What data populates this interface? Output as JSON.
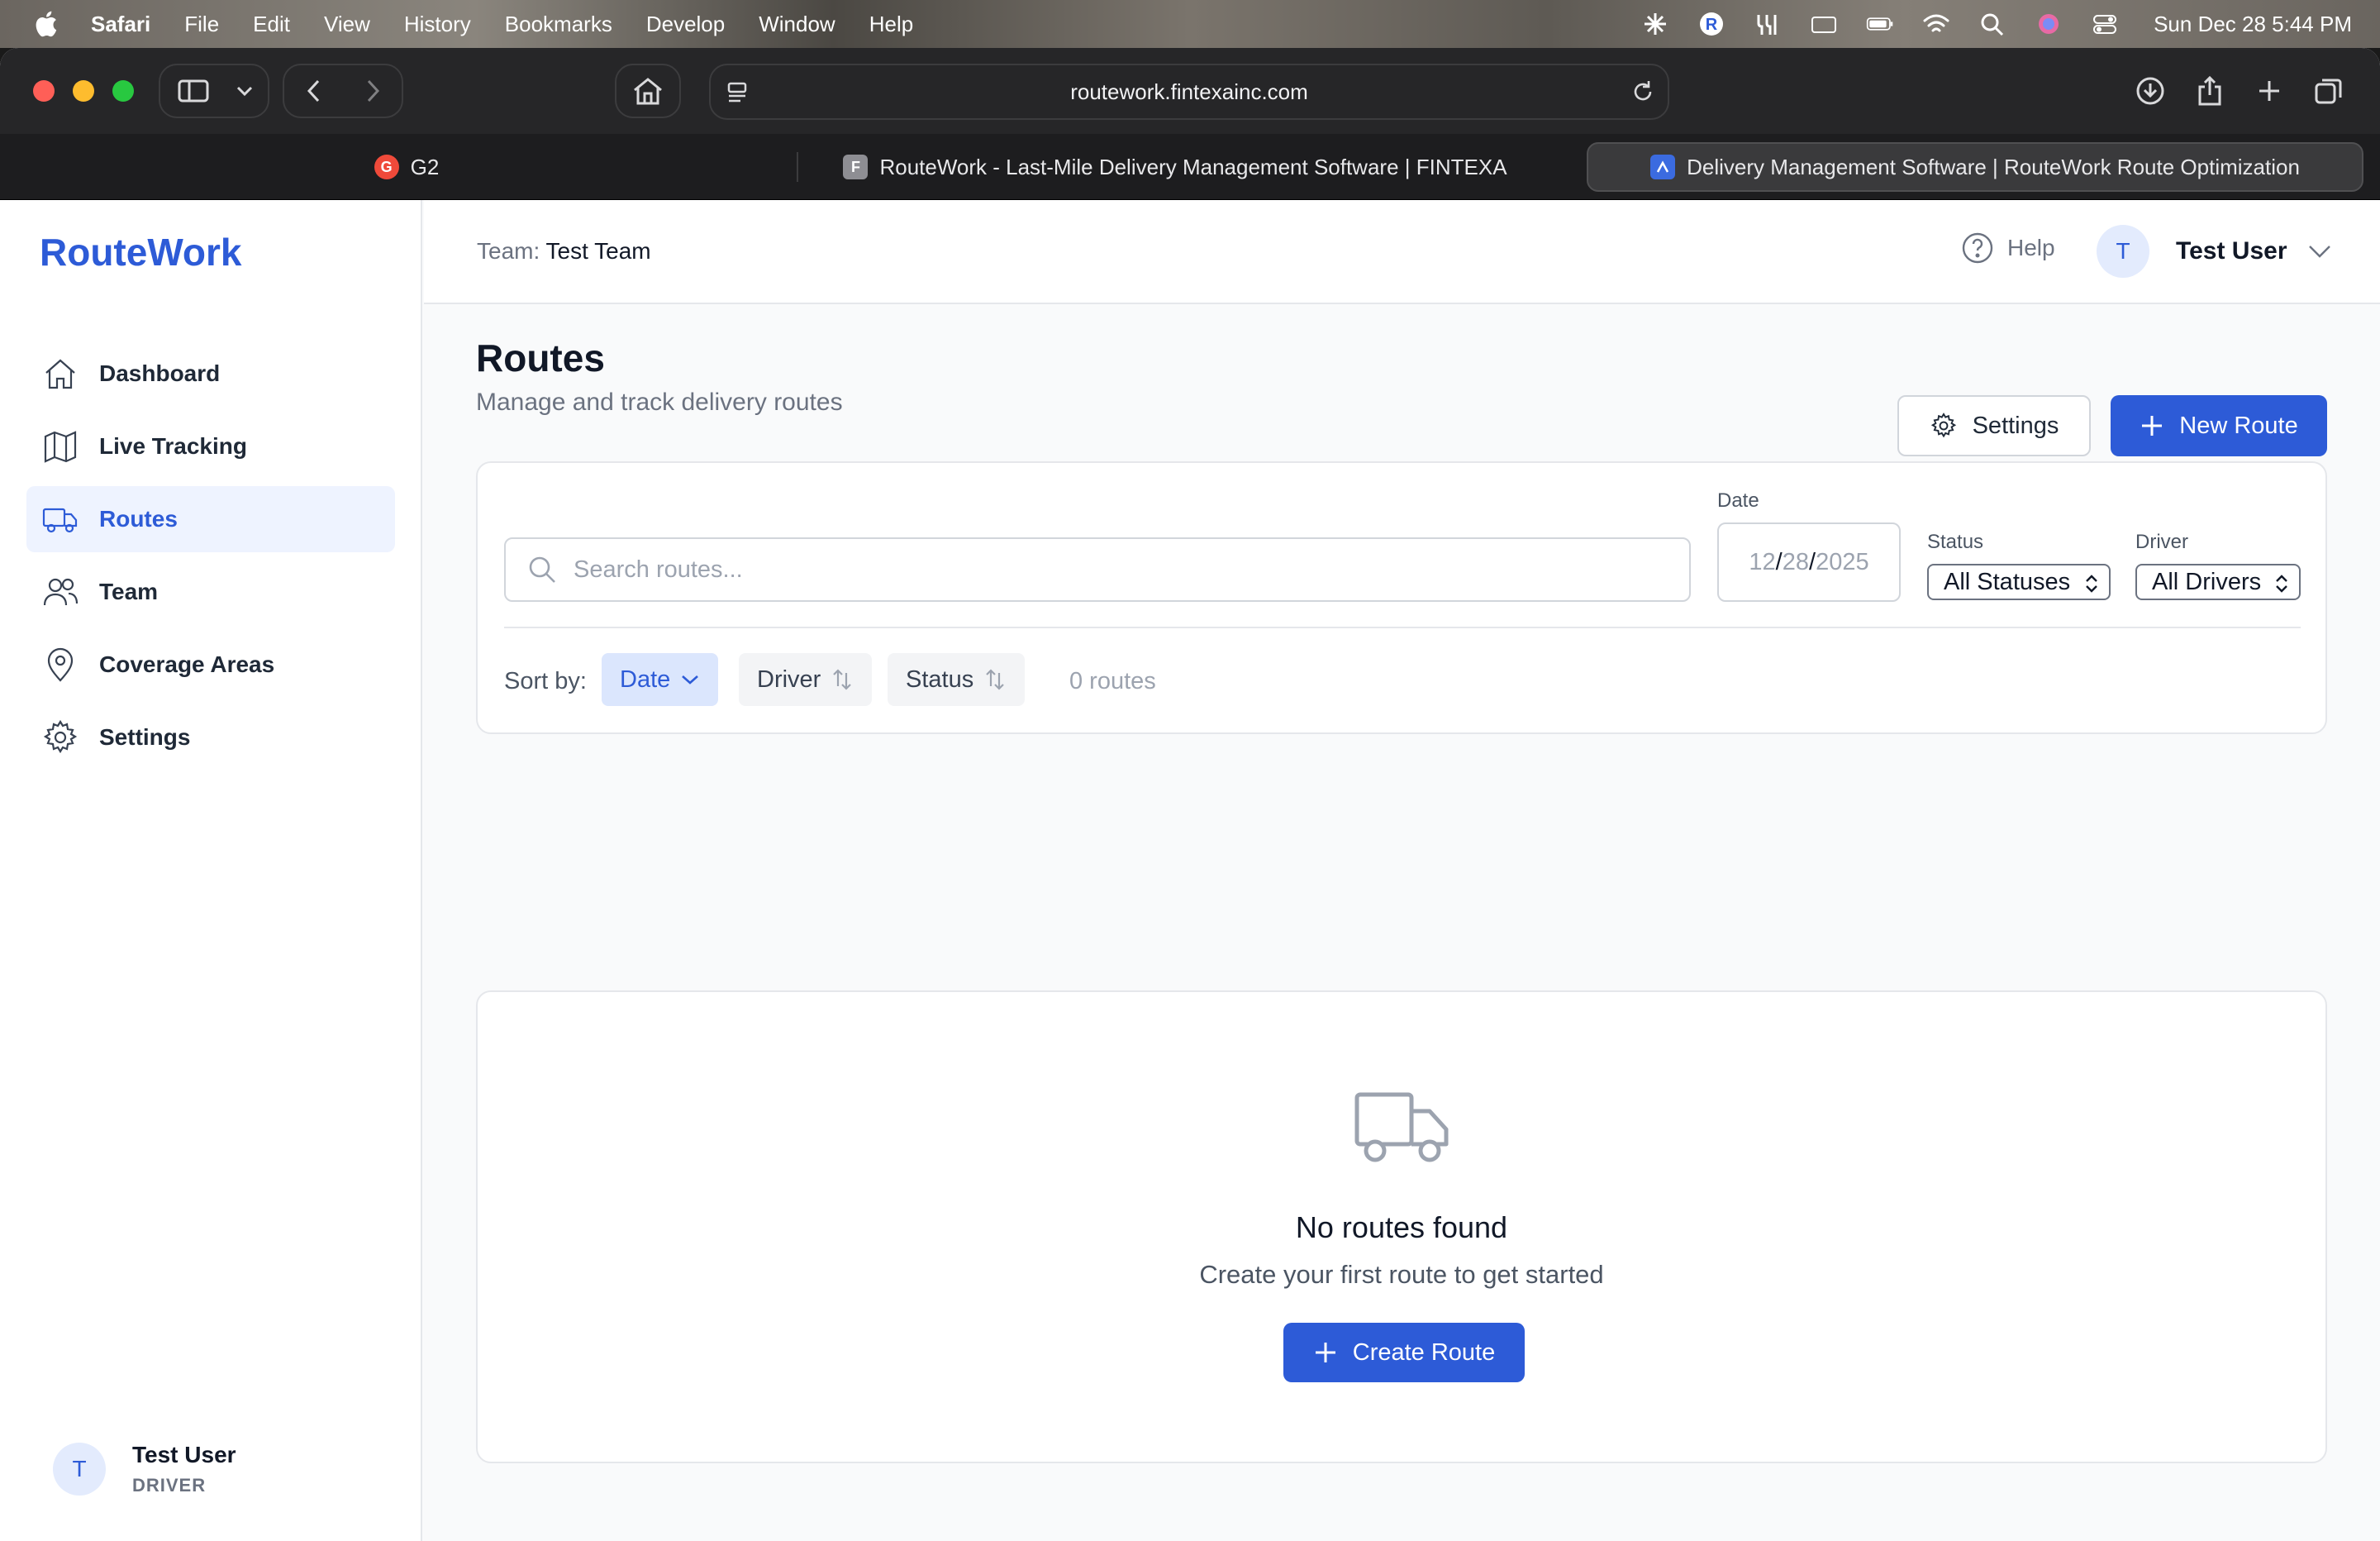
{
  "menubar": {
    "app_name": "Safari",
    "items": [
      "File",
      "Edit",
      "View",
      "History",
      "Bookmarks",
      "Develop",
      "Window",
      "Help"
    ],
    "clock": "Sun Dec 28  5:44 PM"
  },
  "browser": {
    "url": "routework.fintexainc.com",
    "tabs": [
      {
        "title": "G2",
        "favicon": "G"
      },
      {
        "title": "RouteWork - Last-Mile Delivery Management Software | FINTEXA",
        "favicon": "F"
      },
      {
        "title": "Delivery Management Software | RouteWork Route Optimization",
        "favicon": "route-icon"
      }
    ]
  },
  "sidebar": {
    "brand": "RouteWork",
    "items": [
      {
        "label": "Dashboard",
        "icon": "home-icon"
      },
      {
        "label": "Live Tracking",
        "icon": "map-icon"
      },
      {
        "label": "Routes",
        "icon": "truck-icon"
      },
      {
        "label": "Team",
        "icon": "users-icon"
      },
      {
        "label": "Coverage Areas",
        "icon": "map-pin-icon"
      },
      {
        "label": "Settings",
        "icon": "gear-icon"
      }
    ],
    "active_item": "Routes",
    "user": {
      "initial": "T",
      "name": "Test User",
      "role": "DRIVER"
    }
  },
  "header": {
    "team_label": "Team:",
    "team_name": "Test Team",
    "help_label": "Help",
    "user_initial": "T",
    "user_name": "Test User"
  },
  "main": {
    "title": "Routes",
    "subtitle": "Manage and track delivery routes",
    "settings_button": "Settings",
    "new_route_button": "New Route",
    "filters": {
      "search_placeholder": "Search routes...",
      "date_label": "Date",
      "date_month": "12",
      "date_day": "28",
      "date_year": "2025",
      "status_label": "Status",
      "status_value": "All Statuses",
      "driver_label": "Driver",
      "driver_value": "All Drivers"
    },
    "sort": {
      "label": "Sort by:",
      "options": [
        "Date",
        "Driver",
        "Status"
      ],
      "active": "Date",
      "count": "0 routes"
    },
    "empty": {
      "title": "No routes found",
      "subtitle": "Create your first route to get started",
      "button": "Create Route"
    }
  },
  "colors": {
    "accent": "#2d5bd7",
    "accent_light": "#eef3ff",
    "text_muted": "#6b7280"
  }
}
